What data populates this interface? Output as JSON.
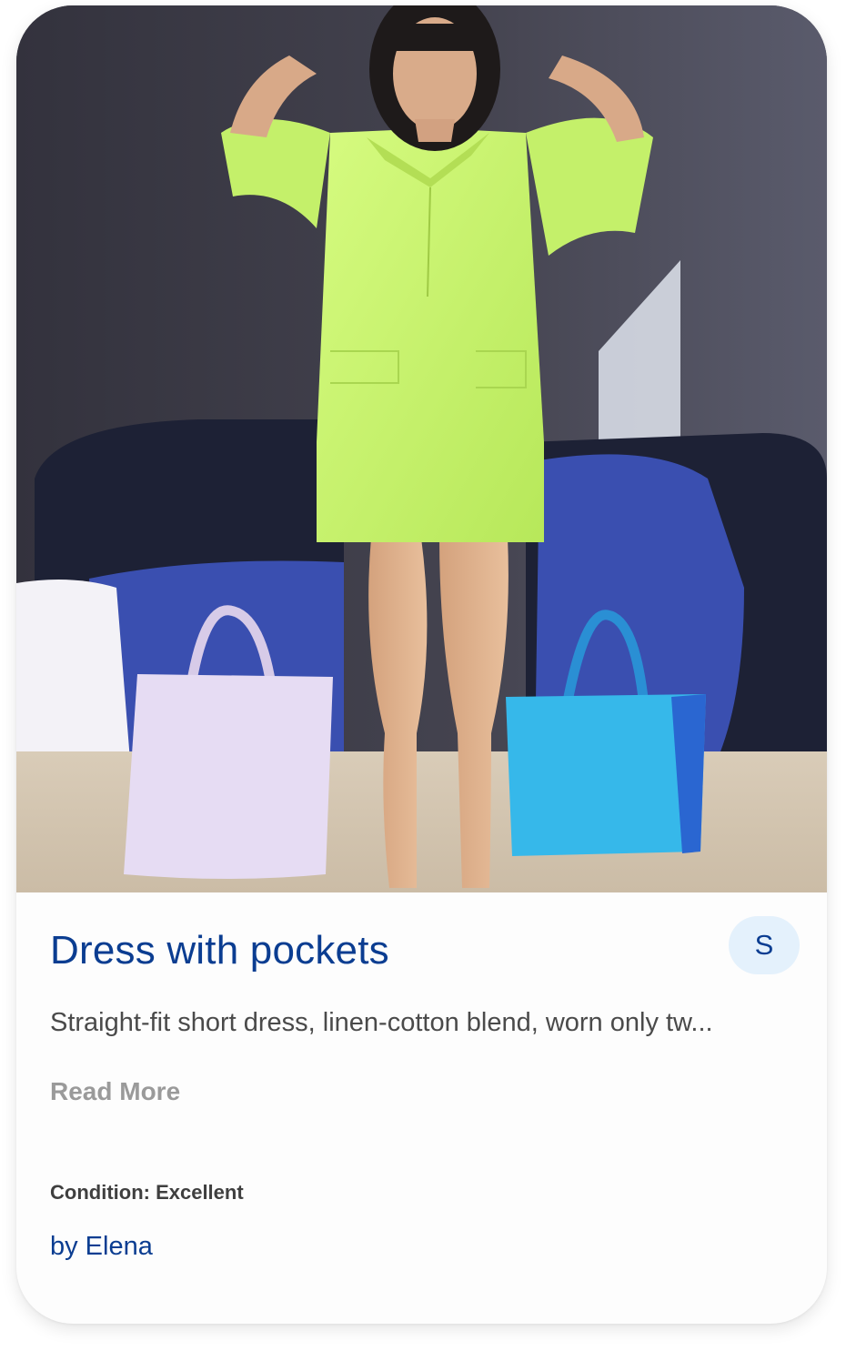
{
  "product": {
    "title": "Dress with pockets",
    "avatar_initial": "S",
    "description": "Straight-fit short dress, linen-cotton blend, worn only tw...",
    "read_more_label": "Read More",
    "condition_text": "Condition: Excellent",
    "author_text": "by Elena"
  },
  "colors": {
    "title": "#0b3d91",
    "avatar_bg": "#e4f1fc",
    "dress": "#c9f56c",
    "wall": "#3b3a46",
    "blanket": "#3a4fb0",
    "bag_left": "#e6dcf3",
    "bag_right": "#36b8ea"
  }
}
